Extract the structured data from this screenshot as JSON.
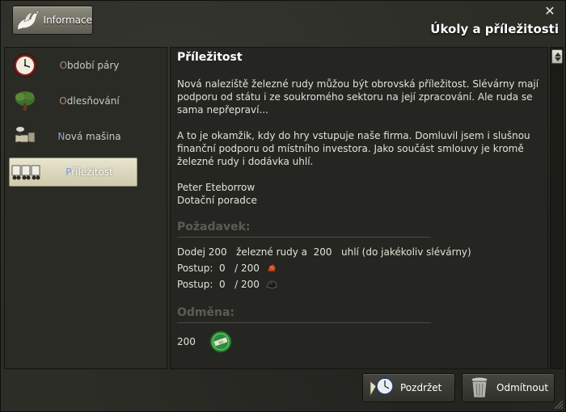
{
  "header": {
    "info_label": "Informace",
    "title": "Úkoly a příležitosti"
  },
  "sidebar": {
    "items": [
      {
        "first": "O",
        "rest": "bdobí páry",
        "icon": "clock-icon"
      },
      {
        "first": "O",
        "rest": "dlesňování",
        "icon": "tree-icon"
      },
      {
        "first": "N",
        "rest": "ová mašina",
        "icon": "locomotive-icon"
      },
      {
        "first": "P",
        "rest": "říležitost",
        "icon": "wagon-icon",
        "active": true
      }
    ]
  },
  "content": {
    "title": "Příležitost",
    "para1": "Nová naleziště železné rudy můžou být obrovská příležitost. Slévárny mají podporu od státu i ze soukromého sektoru na její zpracování. Ale ruda se sama nepřepraví...",
    "para2": "A to je okamžik, kdy do hry vstupuje naše firma. Domluvil jsem i slušnou finanční podporu od místního investora. Jako součást smlouvy je kromě železné rudy i dodávka uhlí.",
    "sign_name": "Peter Eteborrow",
    "sign_role": "Dotační poradce",
    "requirement_heading": "Požadavek:",
    "requirement_text": "Dodej 200   železné rudy a  200   uhlí (do jakékoliv slévárny)",
    "progress1": "Postup:  0   / 200",
    "progress2": "Postup:  0   / 200",
    "reward_heading": "Odměna:",
    "reward_value": "200"
  },
  "footer": {
    "hold_label": "Pozdržet",
    "refuse_label": "Odmítnout"
  },
  "colors": {
    "active_item_bg": "#dcd7bc",
    "heading_muted": "#5b5c53"
  }
}
